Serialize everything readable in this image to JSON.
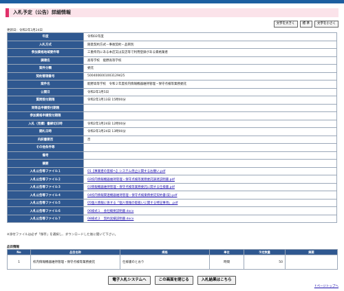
{
  "header": {
    "title": "入札予定（公告）詳細情報"
  },
  "font_size_buttons": [
    {
      "label": "文字を大きく",
      "name": "font-larger-button"
    },
    {
      "label": "標 準",
      "name": "font-standard-button"
    },
    {
      "label": "文字を小さく",
      "name": "font-smaller-button"
    }
  ],
  "updated": "更新日：令和2年3月24日",
  "details": [
    {
      "label": "年度",
      "value": "令和02年度"
    },
    {
      "label": "入札方式",
      "value": "随意契約方式－事後契約・品目別"
    },
    {
      "label": "参加資格地域要件等",
      "value": "三重県内にある本店又は支店等で利用登録がある資格業者"
    },
    {
      "label": "調達名",
      "value": "高等学校　能野高等学校"
    },
    {
      "label": "案件分類",
      "value": "委託"
    },
    {
      "label": "契約管理番号",
      "value": "5004006001003129425"
    },
    {
      "label": "案件名",
      "value": "能野高等学校　令和２年度校内情報機器維持管理・保守点検等業務委託"
    },
    {
      "label": "公開日",
      "value": "令和2年3月5日"
    },
    {
      "label": "質問受付期限",
      "value": "令和2年3月13日 15時00分"
    },
    {
      "label": "同等品申請受付期限",
      "value": ""
    },
    {
      "label": "参加資格申請受付期限",
      "value": ""
    },
    {
      "label": "入札（見積）書締切日時",
      "value": "令和2年3月24日 12時00分"
    },
    {
      "label": "開札日時",
      "value": "令和2年3月24日 13時00分"
    },
    {
      "label": "内訳書要否",
      "value": "否"
    },
    {
      "label": "その他条件等",
      "value": ""
    },
    {
      "label": "備考",
      "value": ""
    },
    {
      "label": "摘要",
      "value": ""
    },
    {
      "label": "入札公告等ファイル１",
      "value": "01【事業者の皆様へ】システム停止に関するお願い.pdf",
      "link": true
    },
    {
      "label": "入札公告等ファイル２",
      "value": "02校内情報機器維持管理・保守点検等業務委託調達説明書.pdf",
      "link": true
    },
    {
      "label": "入札公告等ファイル３",
      "value": "03情報機器維持管理・保守点検等業務委託に関する仕様書.pdf",
      "link": true
    },
    {
      "label": "入札公告等ファイル４",
      "value": "04校内情報関連機器維持管理・保守点検業務委託契約書(案).pdf",
      "link": true
    },
    {
      "label": "入札公告等ファイル５",
      "value": "05個人情報に係する「個人情報の取扱いに関する特記事項」.pdf",
      "link": true
    },
    {
      "label": "入札公告等ファイル６",
      "value": "06様式１　会社概要説明書.docx",
      "link": true
    },
    {
      "label": "入札公告等ファイル７",
      "value": "08様式２　契約実績説明書.docx",
      "link": true
    }
  ],
  "note": "※添付ファイルは必ず「保存」を選択し、ダウンロードした後に開いて下さい。",
  "items_title": "品目情報",
  "items_table": {
    "headers": [
      "No",
      "品目名称",
      "規格",
      "単位",
      "予定数量",
      "摘要"
    ],
    "rows": [
      {
        "no": "1",
        "name": "校内情報機器維持管理・保守点検等業務委託",
        "spec": "仕様書のとおり",
        "unit": "時間",
        "qty": "50",
        "remark": ""
      }
    ]
  },
  "bottom_buttons": [
    {
      "label": "電子入札システムへ",
      "name": "e-bidding-system-button"
    },
    {
      "label": "この画面を閉じる",
      "name": "close-window-button"
    },
    {
      "label": "入札結果はこちら",
      "name": "bid-results-button"
    }
  ],
  "page_top": "↑ページトップへ"
}
